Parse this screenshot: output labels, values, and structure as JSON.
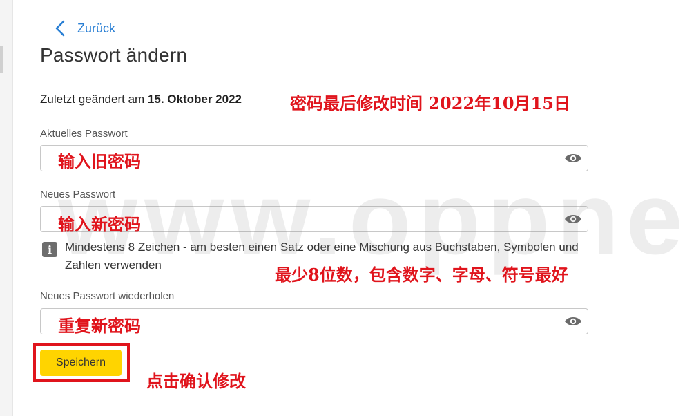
{
  "back": {
    "label": "Zurück"
  },
  "page": {
    "title": "Passwort ändern"
  },
  "last_changed": {
    "prefix": "Zuletzt geändert am ",
    "date": "15. Oktober 2022"
  },
  "fields": [
    {
      "label": "Aktuelles Passwort",
      "value": "",
      "placeholder": ""
    },
    {
      "label": "Neues Passwort",
      "value": "",
      "placeholder": ""
    },
    {
      "label": "Neues Passwort wiederholen",
      "value": "",
      "placeholder": ""
    }
  ],
  "hint": {
    "text": "Mindestens 8 Zeichen - am besten einen Satz oder eine Mischung aus Buchstaben, Symbolen und Zahlen verwenden"
  },
  "save": {
    "label": "Speichern"
  },
  "annotations": {
    "last_changed": "密码最后修改时间 2022年10月15日",
    "old_password": "输入旧密码",
    "new_password": "输入新密码",
    "rules": "最少8位数，包含数字、字母、符号最好",
    "repeat_password": "重复新密码",
    "confirm": "点击确认修改"
  },
  "watermark": "www.oppne.top",
  "icons": {
    "back": "chevron-left-icon",
    "eye": "eye-icon",
    "info": "info-icon"
  },
  "colors": {
    "accent": "#2a7fd4",
    "button": "#ffd400",
    "annotation": "#e0141c"
  }
}
